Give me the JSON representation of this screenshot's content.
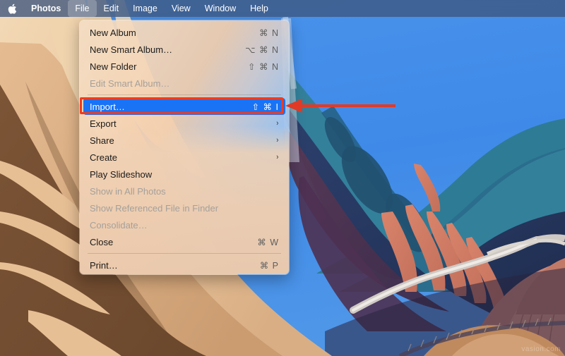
{
  "menubar": {
    "apple_icon": "apple-logo-icon",
    "items": [
      {
        "label": "Photos",
        "bold": true,
        "active": false
      },
      {
        "label": "File",
        "bold": false,
        "active": true
      },
      {
        "label": "Edit",
        "bold": false,
        "active": false
      },
      {
        "label": "Image",
        "bold": false,
        "active": false
      },
      {
        "label": "View",
        "bold": false,
        "active": false
      },
      {
        "label": "Window",
        "bold": false,
        "active": false
      },
      {
        "label": "Help",
        "bold": false,
        "active": false
      }
    ]
  },
  "file_menu": {
    "title": "File",
    "rows": [
      {
        "type": "item",
        "label": "New Album",
        "shortcut": "⌘ N",
        "arrow": "",
        "disabled": false,
        "selected": false
      },
      {
        "type": "item",
        "label": "New Smart Album…",
        "shortcut": "⌥ ⌘ N",
        "arrow": "",
        "disabled": false,
        "selected": false
      },
      {
        "type": "item",
        "label": "New Folder",
        "shortcut": "⇧ ⌘ N",
        "arrow": "",
        "disabled": false,
        "selected": false
      },
      {
        "type": "item",
        "label": "Edit Smart Album…",
        "shortcut": "",
        "arrow": "",
        "disabled": true,
        "selected": false
      },
      {
        "type": "separator"
      },
      {
        "type": "item",
        "label": "Import…",
        "shortcut": "⇧ ⌘ I",
        "arrow": "",
        "disabled": false,
        "selected": true
      },
      {
        "type": "item",
        "label": "Export",
        "shortcut": "",
        "arrow": "›",
        "disabled": false,
        "selected": false
      },
      {
        "type": "item",
        "label": "Share",
        "shortcut": "",
        "arrow": "›",
        "disabled": false,
        "selected": false
      },
      {
        "type": "item",
        "label": "Create",
        "shortcut": "",
        "arrow": "›",
        "disabled": false,
        "selected": false
      },
      {
        "type": "item",
        "label": "Play Slideshow",
        "shortcut": "",
        "arrow": "",
        "disabled": false,
        "selected": false
      },
      {
        "type": "item",
        "label": "Show in All Photos",
        "shortcut": "",
        "arrow": "",
        "disabled": true,
        "selected": false
      },
      {
        "type": "item",
        "label": "Show Referenced File in Finder",
        "shortcut": "",
        "arrow": "",
        "disabled": true,
        "selected": false
      },
      {
        "type": "item",
        "label": "Consolidate…",
        "shortcut": "",
        "arrow": "",
        "disabled": true,
        "selected": false
      },
      {
        "type": "item",
        "label": "Close",
        "shortcut": "⌘ W",
        "arrow": "",
        "disabled": false,
        "selected": false
      },
      {
        "type": "separator"
      },
      {
        "type": "item",
        "label": "Print…",
        "shortcut": "⌘ P",
        "arrow": "",
        "disabled": false,
        "selected": false
      }
    ]
  },
  "annotations": {
    "highlight_color": "#ef3b1f",
    "highlight_target": "Import…",
    "arrow": "red-left-arrow-icon"
  },
  "watermark": {
    "text": "vasion.com"
  },
  "colors": {
    "menubar_bg": "#3e567e",
    "selection_blue": "#1a73f5",
    "sky_blue": "#3f8ae8",
    "menu_tan": "#eecdac"
  }
}
